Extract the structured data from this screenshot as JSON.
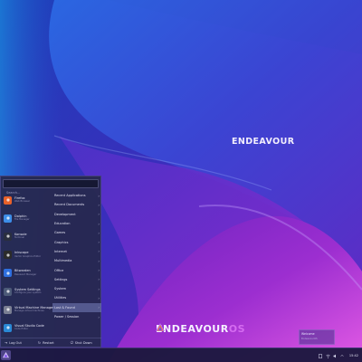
{
  "desktop": {
    "logo_main": "ENDEAVOUR",
    "logo_bottom_main": "ENDEAVOUR",
    "logo_bottom_accent": "OS"
  },
  "launcher": {
    "search_placeholder": "Search...",
    "favorites": [
      {
        "name": "Firefox",
        "desc": "Web Browser",
        "icon": "firefox-icon",
        "color": "#e8612a"
      },
      {
        "name": "Dolphin",
        "desc": "File Manager",
        "icon": "dolphin-icon",
        "color": "#3d8ee8"
      },
      {
        "name": "Konsole",
        "desc": "Terminal",
        "icon": "konsole-icon",
        "color": "#2a2f3f"
      },
      {
        "name": "Inkscape",
        "desc": "Vector Graphics Editor",
        "icon": "inkscape-icon",
        "color": "#2b2b2b"
      },
      {
        "name": "Bitwarden",
        "desc": "Password Manager",
        "icon": "bitwarden-icon",
        "color": "#2e6fe0"
      },
      {
        "name": "System Settings",
        "desc": "Configure your system",
        "icon": "settings-icon",
        "color": "#4c5a78"
      },
      {
        "name": "Virtual Machine Manager",
        "desc": "Manage virtual machines",
        "icon": "vm-icon",
        "color": "#7a7f93"
      },
      {
        "name": "Visual Studio Code",
        "desc": "Code Editor",
        "icon": "vscode-icon",
        "color": "#2a89d6"
      }
    ],
    "categories": [
      {
        "label": "Recent Applications"
      },
      {
        "label": "Recent Documents"
      },
      {
        "label": "Development"
      },
      {
        "label": "Education"
      },
      {
        "label": "Games"
      },
      {
        "label": "Graphics"
      },
      {
        "label": "Internet"
      },
      {
        "label": "Multimedia"
      },
      {
        "label": "Office"
      },
      {
        "label": "Settings"
      },
      {
        "label": "System"
      },
      {
        "label": "Utilities"
      },
      {
        "label": "Lost & Found"
      },
      {
        "label": "Power / Session"
      }
    ],
    "active_category": 12,
    "power": [
      {
        "label": "Log Out",
        "icon": "logout-icon"
      },
      {
        "label": "Restart",
        "icon": "restart-icon"
      },
      {
        "label": "Shut Down",
        "icon": "shutdown-icon"
      }
    ]
  },
  "taskbar": {
    "clock": "15:42"
  },
  "notification": {
    "title": "Welcome",
    "body": "EndeavourOS"
  },
  "colors": {
    "accent": "#7f3fbf",
    "wallpaper_top": "#1e2fb0",
    "wallpaper_right": "#d94ae0"
  }
}
